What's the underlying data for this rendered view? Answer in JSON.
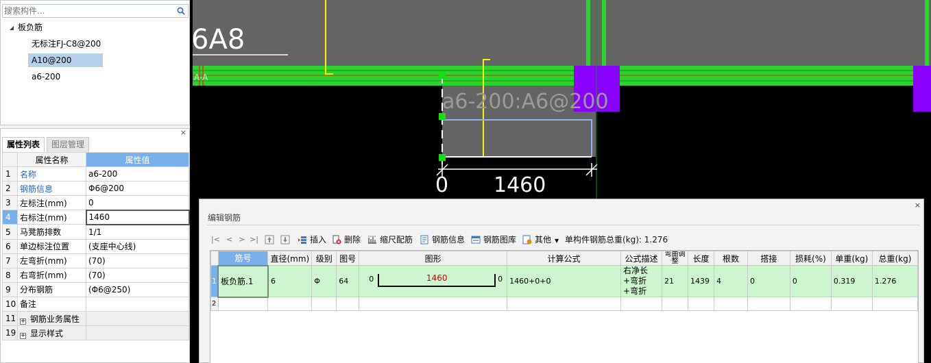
{
  "search": {
    "placeholder": "搜索构件..."
  },
  "tree": {
    "root": "板负筋",
    "children": [
      "无标注FJ-C8@200",
      "A10@200",
      "a6-200"
    ]
  },
  "prop_panel": {
    "close_glyph": "×",
    "tabs": [
      "属性列表",
      "图层管理"
    ],
    "headers": {
      "name": "属性名称",
      "value": "属性值"
    },
    "rows": [
      {
        "idx": "1",
        "name": "名称",
        "value": "a6-200"
      },
      {
        "idx": "2",
        "name": "钢筋信息",
        "value": "Φ6@200"
      },
      {
        "idx": "3",
        "name": "左标注(mm)",
        "value": "0"
      },
      {
        "idx": "4",
        "name": "右标注(mm)",
        "value": "1460"
      },
      {
        "idx": "5",
        "name": "马凳筋排数",
        "value": "1/1"
      },
      {
        "idx": "6",
        "name": "单边标注位置",
        "value": "(支座中心线)"
      },
      {
        "idx": "7",
        "name": "左弯折(mm)",
        "value": "(70)"
      },
      {
        "idx": "8",
        "name": "右弯折(mm)",
        "value": "(70)"
      },
      {
        "idx": "9",
        "name": "分布钢筋",
        "value": "(Φ6@250)"
      },
      {
        "idx": "10",
        "name": "备注",
        "value": ""
      },
      {
        "idx": "11",
        "name": "钢筋业务属性",
        "value": ""
      },
      {
        "idx": "19",
        "name": "显示样式",
        "value": ""
      }
    ]
  },
  "cad": {
    "label_top": "6A8",
    "label_aa": "A-A",
    "rebar_label": "a6-200:A6@200",
    "dim_left": "0",
    "dim_main": "1460"
  },
  "dialog": {
    "close_glyph": "×",
    "title": "编辑钢筋",
    "toolbar": {
      "nav": [
        "|<",
        "<",
        ">",
        ">|"
      ],
      "insert": "插入",
      "delete": "删除",
      "scale": "缩尺配筋",
      "info": "钢筋信息",
      "library": "钢筋图库",
      "other": "其他",
      "total_label": "单构件钢筋总重(kg): 1.276"
    },
    "columns": [
      "筋号",
      "直径(mm)",
      "级别",
      "图号",
      "图形",
      "计算公式",
      "公式描述",
      "弯曲调整",
      "长度",
      "根数",
      "搭接",
      "损耗(%)",
      "单重(kg)",
      "总重(kg)"
    ],
    "rows": [
      {
        "idx": "1",
        "name": "板负筋.1",
        "diameter": "6",
        "grade": "Φ",
        "fig_no": "64",
        "shape_left": "0",
        "shape_len": "1460",
        "shape_right": "0",
        "formula": "1460+0+0",
        "desc": "右净长+弯折+弯折",
        "bend_adj": "21",
        "length": "1439",
        "count": "4",
        "lap": "0",
        "loss": "0",
        "unit_w": "0.319",
        "total_w": "1.276"
      }
    ],
    "empty_row_idx": "2"
  },
  "colors": {
    "cad_bg": "#000000",
    "slab_gray": "#646464",
    "beam_green": "#2bd42b",
    "column_purple": "#8a00ff",
    "rebar_yellow": "#ffee00",
    "selection_blue": "#78b0ec",
    "row_green": "#cdf5cf"
  }
}
